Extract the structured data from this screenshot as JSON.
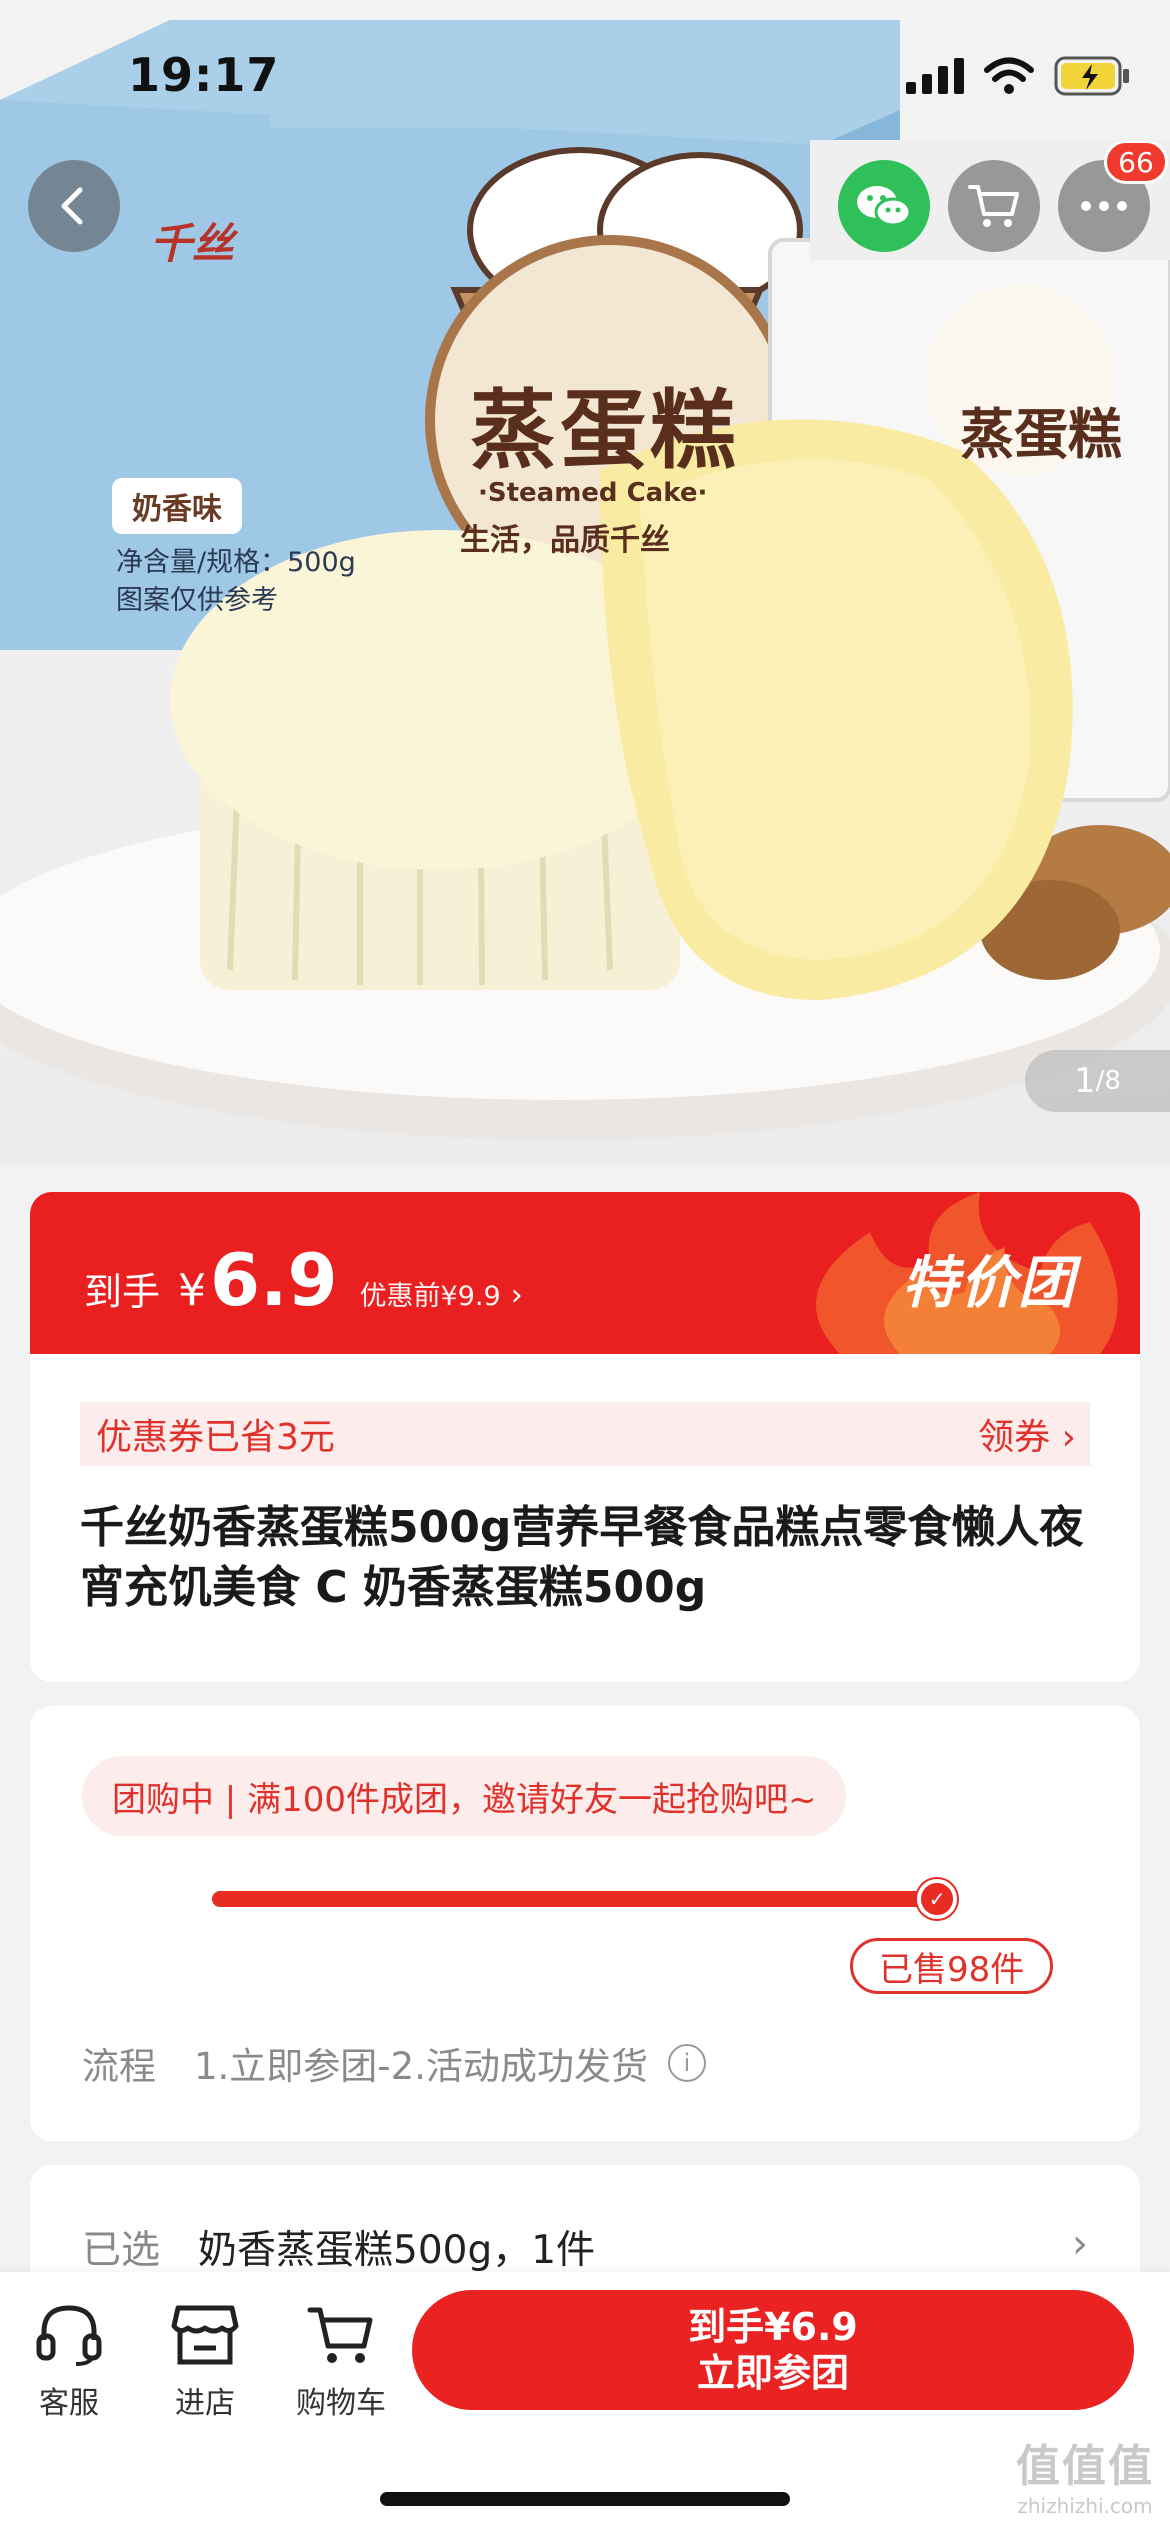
{
  "status_bar": {
    "time": "19:17"
  },
  "nav": {
    "cart_badge": "66"
  },
  "gallery": {
    "current": "1",
    "total": "/8"
  },
  "product_image_text": {
    "box_brand": "千丝",
    "box_title": "蒸蛋糕",
    "box_subtitle": "·Steamed Cake·",
    "box_slogan": "生活，品质千丝",
    "flavor_tag": "奶香味",
    "net_spec": "净含量/规格：500g",
    "picture_note": "图案仅供参考"
  },
  "price": {
    "lead": "到手",
    "yen": "¥",
    "value": "6.9",
    "original": "优惠前¥9.9",
    "chevron": "›",
    "deal_logo": "特价团"
  },
  "coupon": {
    "left": "优惠券已省3元",
    "right": "领券 ›"
  },
  "product": {
    "title": " 千丝奶香蒸蛋糕500g营养早餐食品糕点零食懒人夜宵充饥美食 C 奶香蒸蛋糕500g"
  },
  "group": {
    "status_text": "团购中 | 满100件成团，邀请好友一起抢购吧~",
    "progress": 0.98,
    "sold_text": "已售98件",
    "flow_label": "流程",
    "flow_text": "1.立即参团-2.活动成功发货",
    "info_icon": "i"
  },
  "selected": {
    "label": "已选",
    "value": "奶香蒸蛋糕500g，1件",
    "chevron": "›"
  },
  "bottom_bar": {
    "customer_service": "客服",
    "store": "进店",
    "cart": "购物车",
    "buy_line1": "到手¥6.9",
    "buy_line2": "立即参团"
  },
  "watermark": {
    "big": "值值值",
    "small": "zhizhizhi.com"
  },
  "colors": {
    "accent": "#ea1f1f",
    "accent_light": "#fdecec",
    "wechat": "#2fc05a"
  }
}
